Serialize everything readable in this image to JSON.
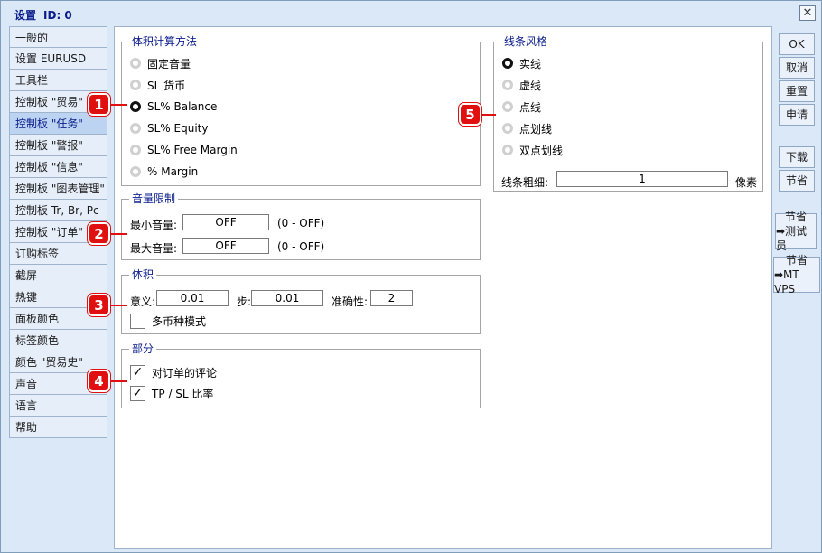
{
  "window": {
    "title": "设置",
    "id_label": "ID: 0",
    "close_label": "✕"
  },
  "sidebar": {
    "items": [
      {
        "label": "一般的"
      },
      {
        "label": "设置 EURUSD"
      },
      {
        "label": "工具栏"
      },
      {
        "label": "控制板 \"贸易\""
      },
      {
        "label": "控制板 \"任务\""
      },
      {
        "label": "控制板 \"警报\""
      },
      {
        "label": "控制板 \"信息\""
      },
      {
        "label": "控制板 \"图表管理\""
      },
      {
        "label": "控制板 Tr, Br, Pc"
      },
      {
        "label": "控制板 \"订单\""
      },
      {
        "label": "订购标签"
      },
      {
        "label": "截屏"
      },
      {
        "label": "热键"
      },
      {
        "label": "面板颜色"
      },
      {
        "label": "标签颜色"
      },
      {
        "label": "颜色 \"贸易史\""
      },
      {
        "label": "声音"
      },
      {
        "label": "语言"
      },
      {
        "label": "帮助"
      }
    ],
    "active_index": 4
  },
  "volume_calc": {
    "legend": "体积计算方法",
    "options": [
      "固定音量",
      "SL 货币",
      "SL% Balance",
      "SL% Equity",
      "SL% Free Margin",
      "% Margin"
    ],
    "selected": 2
  },
  "volume_limit": {
    "legend": "音量限制",
    "min_label": "最小音量:",
    "min_value": "OFF",
    "min_hint": "(0 - OFF)",
    "max_label": "最大音量:",
    "max_value": "OFF",
    "max_hint": "(0 - OFF)"
  },
  "volume": {
    "legend": "体积",
    "meaning_label": "意义:",
    "meaning_value": "0.01",
    "step_label": "步:",
    "step_value": "0.01",
    "accuracy_label": "准确性:",
    "accuracy_value": "2",
    "multi_label": "多币种模式",
    "multi_checked": false
  },
  "section": {
    "legend": "部分",
    "comment_label": "对订单的评论",
    "comment_checked": true,
    "tpsl_label": "TP / SL 比率",
    "tpsl_checked": true
  },
  "line_style": {
    "legend": "线条风格",
    "options": [
      "实线",
      "虚线",
      "点线",
      "点划线",
      "双点划线"
    ],
    "selected": 0,
    "width_label": "线条粗细:",
    "width_value": "1",
    "width_unit": "像素"
  },
  "buttons": {
    "ok": "OK",
    "cancel": "取消",
    "reset": "重置",
    "apply": "申请",
    "download": "下载",
    "save": "节省",
    "save_tester_1": "节省",
    "save_tester_2": "➡测试员",
    "save_vps_1": "节省",
    "save_vps_2": "➡MT VPS"
  },
  "badges": [
    "1",
    "2",
    "3",
    "4",
    "5"
  ],
  "colors": {
    "accent": "#0a1d8c",
    "badge": "#e01010",
    "window_bg": "#dbe8f8"
  }
}
